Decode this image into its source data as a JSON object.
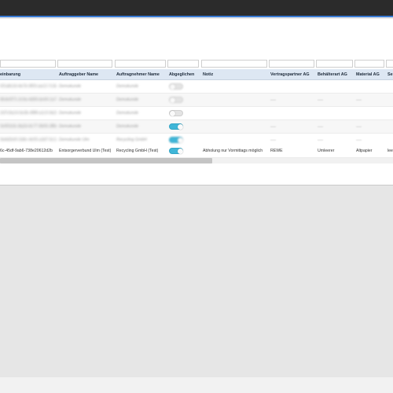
{
  "columns": [
    {
      "label": "einbarung"
    },
    {
      "label": "Auftraggeber Name"
    },
    {
      "label": "Auftragnehmer Name"
    },
    {
      "label": "Abgeglichen"
    },
    {
      "label": "Notiz"
    },
    {
      "label": "Vertragspartner AG"
    },
    {
      "label": "Behälterart AG"
    },
    {
      "label": "Material AG"
    },
    {
      "label": "Se"
    }
  ],
  "rows": [
    {
      "vereinbarung": "6f1a8c2d-4e7b-9f03-aa12-7c3e1d9b",
      "auftraggeber": "Demokunde",
      "auftragnehmer": "Demokunde",
      "abgeglichen": false,
      "notiz": "",
      "vertragspartner": "",
      "behaelterart": "",
      "material": "",
      "se": ""
    },
    {
      "vereinbarung": "8b3e5f71-2c9a-4d06-be44-1a7f2c8e",
      "auftraggeber": "Demokunde",
      "auftragnehmer": "Demokunde",
      "abgeglichen": false,
      "notiz": "",
      "vertragspartner": "—",
      "behaelterart": "—",
      "material": "—",
      "se": ""
    },
    {
      "vereinbarung": "2d7c9a14-6e3b-4f88-a1c5-9e2b7d4f",
      "auftraggeber": "Demokunde",
      "auftragnehmer": "Demokunde",
      "abgeglichen": false,
      "notiz": "",
      "vertragspartner": "",
      "behaelterart": "",
      "material": "",
      "se": ""
    },
    {
      "vereinbarung": "5e9f1b3c-8a2d-4c77-9b06-3f8a1e6c",
      "auftraggeber": "Demokunde",
      "auftragnehmer": "Demokunde",
      "abgeglichen": true,
      "notiz": "",
      "vertragspartner": "—",
      "behaelterart": "—",
      "material": "—",
      "se": ""
    },
    {
      "vereinbarung": "9a4d2e6f-1b8c-4e55-a3d7-6c1f9b2e",
      "auftraggeber": "Demokunde Ulm",
      "auftragnehmer": "Recycling GmbH",
      "abgeglichen": true,
      "notiz": "",
      "vertragspartner": "—",
      "behaelterart": "—",
      "material": "—",
      "se": ""
    },
    {
      "vereinbarung": "6c-45df-9ab6-738e20612d2b",
      "auftraggeber": "Entsorgerverbund Ulm (Test)",
      "auftragnehmer": "Recycling GmbH (Test)",
      "abgeglichen": true,
      "notiz": "Abholung nur Vormittags möglich",
      "vertragspartner": "REWE",
      "behaelterart": "Umleerer",
      "material": "Altpapier",
      "se": "lee"
    }
  ],
  "scrollbar": {
    "position": 0.54
  }
}
